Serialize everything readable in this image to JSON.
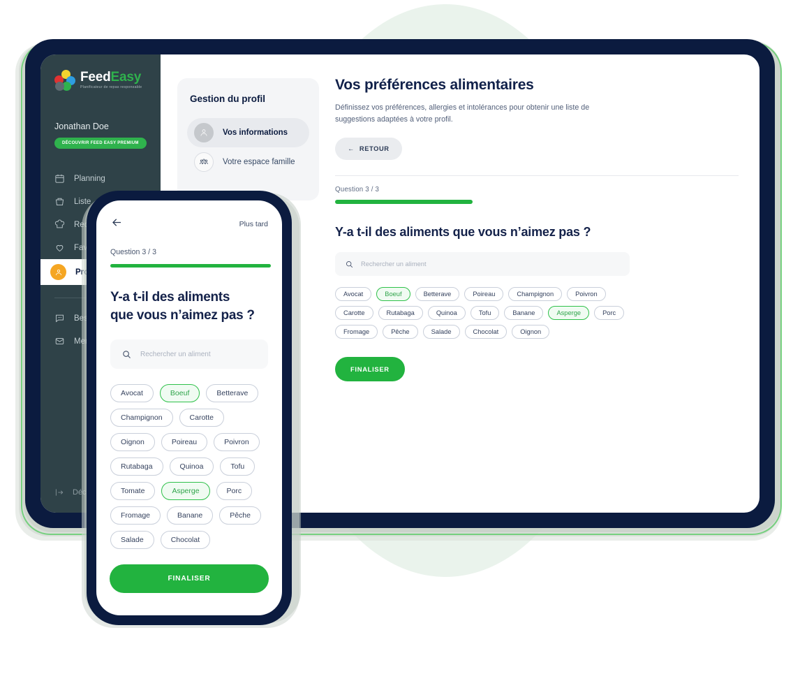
{
  "brand": {
    "name_part1": "Feed",
    "name_part2": "Easy",
    "tagline": "Planificateur de repas responsable",
    "colors": {
      "green": "#2fb24d",
      "navy": "#0b1b3f",
      "sidebar": "#2f4248",
      "accent_green": "#22b33f",
      "orange": "#f5a623"
    }
  },
  "sidebar": {
    "user_name": "Jonathan Doe",
    "premium_badge": "DÉCOUVRIR FEED EASY PREMIUM",
    "items": [
      {
        "label": "Planning",
        "icon": "calendar-icon",
        "active": false
      },
      {
        "label": "Liste",
        "icon": "basket-icon",
        "active": false
      },
      {
        "label": "Recettes",
        "icon": "chef-hat-icon",
        "active": false
      },
      {
        "label": "Favoris",
        "icon": "heart-icon",
        "active": false
      },
      {
        "label": "Profil",
        "icon": "user-avatar-icon",
        "active": true
      }
    ],
    "secondary_items": [
      {
        "label": "Besoin d'aide",
        "icon": "chat-icon"
      },
      {
        "label": "Mentions légales",
        "icon": "mail-icon"
      }
    ],
    "logout": "Déconnexion"
  },
  "profile_panel": {
    "title": "Gestion du profil",
    "items": [
      {
        "label": "Vos informations",
        "icon": "user-icon",
        "active": true
      },
      {
        "label": "Votre espace famille",
        "icon": "family-icon",
        "active": false
      }
    ]
  },
  "main": {
    "title": "Vos préférences alimentaires",
    "description": "Définissez vos préférences, allergies et intolérances pour obtenir  une liste de suggestions adaptées à votre profil.",
    "back_label": "RETOUR",
    "question_counter": "Question  3 / 3",
    "progress_percent": 47,
    "question_prefix": "Y-a t-il des aliments que ",
    "question_bold": "vous n’aimez pas",
    "question_suffix": " ?",
    "search_placeholder": "Rechercher un aliment",
    "finalize_label": "FINALISER",
    "tags": [
      {
        "label": "Avocat",
        "selected": false
      },
      {
        "label": "Boeuf",
        "selected": true
      },
      {
        "label": "Betterave",
        "selected": false
      },
      {
        "label": "Poireau",
        "selected": false
      },
      {
        "label": "Champignon",
        "selected": false
      },
      {
        "label": "Poivron",
        "selected": false
      },
      {
        "label": "Carotte",
        "selected": false
      },
      {
        "label": "Rutabaga",
        "selected": false
      },
      {
        "label": "Quinoa",
        "selected": false
      },
      {
        "label": "Tofu",
        "selected": false
      },
      {
        "label": "Banane",
        "selected": false
      },
      {
        "label": "Asperge",
        "selected": true
      },
      {
        "label": "Porc",
        "selected": false
      },
      {
        "label": "Fromage",
        "selected": false
      },
      {
        "label": "Pêche",
        "selected": false
      },
      {
        "label": "Salade",
        "selected": false
      },
      {
        "label": "Chocolat",
        "selected": false
      },
      {
        "label": "Oignon",
        "selected": false
      }
    ]
  },
  "phone": {
    "later_label": "Plus tard",
    "question_counter": "Question 3 / 3",
    "progress_percent": 100,
    "question_line1": "Y-a t-il des aliments",
    "question_line2_prefix": "que ",
    "question_line2_bold": "vous n’aimez pas",
    "question_line2_suffix": " ?",
    "search_placeholder": "Rechercher un aliment",
    "finalize_label": "FINALISER",
    "tags": [
      {
        "label": "Avocat",
        "selected": false
      },
      {
        "label": "Boeuf",
        "selected": true
      },
      {
        "label": "Betterave",
        "selected": false
      },
      {
        "label": "Champignon",
        "selected": false
      },
      {
        "label": "Carotte",
        "selected": false
      },
      {
        "label": "Oignon",
        "selected": false
      },
      {
        "label": "Poireau",
        "selected": false
      },
      {
        "label": "Poivron",
        "selected": false
      },
      {
        "label": "Rutabaga",
        "selected": false
      },
      {
        "label": "Quinoa",
        "selected": false
      },
      {
        "label": "Tofu",
        "selected": false
      },
      {
        "label": "Tomate",
        "selected": false
      },
      {
        "label": "Asperge",
        "selected": true
      },
      {
        "label": "Porc",
        "selected": false
      },
      {
        "label": "Fromage",
        "selected": false
      },
      {
        "label": "Banane",
        "selected": false
      },
      {
        "label": "Pêche",
        "selected": false
      },
      {
        "label": "Salade",
        "selected": false
      },
      {
        "label": "Chocolat",
        "selected": false
      }
    ]
  }
}
